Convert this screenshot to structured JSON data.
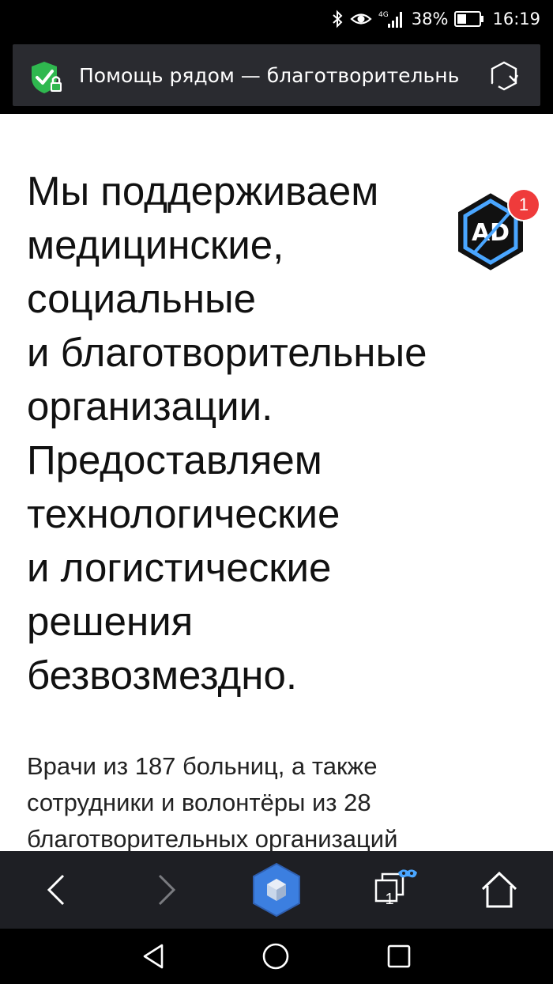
{
  "status_bar": {
    "network": "4G",
    "battery_percent": "38%",
    "time": "16:19",
    "icons": [
      "bluetooth-icon",
      "eye-icon",
      "signal-icon",
      "battery-icon"
    ]
  },
  "url_bar": {
    "title": "Помощь рядом — благотворительнь",
    "security_icon": "shield-check-lock-icon",
    "reload_icon": "reload-icon"
  },
  "content": {
    "headline_lines": [
      "Мы поддерживаем",
      "медицинские,",
      "социальные",
      "и благотворительные",
      "организации.",
      "Предоставляем",
      "технологические",
      "и логистические",
      "решения",
      "безвозмездно."
    ],
    "paragraph_lines": [
      "Врачи из 187 больниц, а также",
      "сотрудники и волонтёры из 28",
      "благотворительных организаций"
    ]
  },
  "adblock": {
    "label": "AD",
    "count": "1",
    "icon": "adblock-icon"
  },
  "toolbar": {
    "back_icon": "back-arrow-icon",
    "forward_icon": "forward-arrow-icon",
    "alice_icon": "alice-hexagon-icon",
    "tabs_count": "1",
    "tabs_icon": "tabs-incognito-icon",
    "home_icon": "home-icon"
  },
  "nav_bar": {
    "back_icon": "nav-back-icon",
    "home_icon": "nav-home-icon",
    "recents_icon": "nav-recents-icon"
  },
  "colors": {
    "shield_green": "#2fb84f",
    "url_bar_bg": "#2a2b30",
    "toolbar_bg": "#1e1f24",
    "badge_red": "#ef3b3b",
    "adblock_blue": "#4aa6ff",
    "alice_blue": "#3c7fe0"
  }
}
